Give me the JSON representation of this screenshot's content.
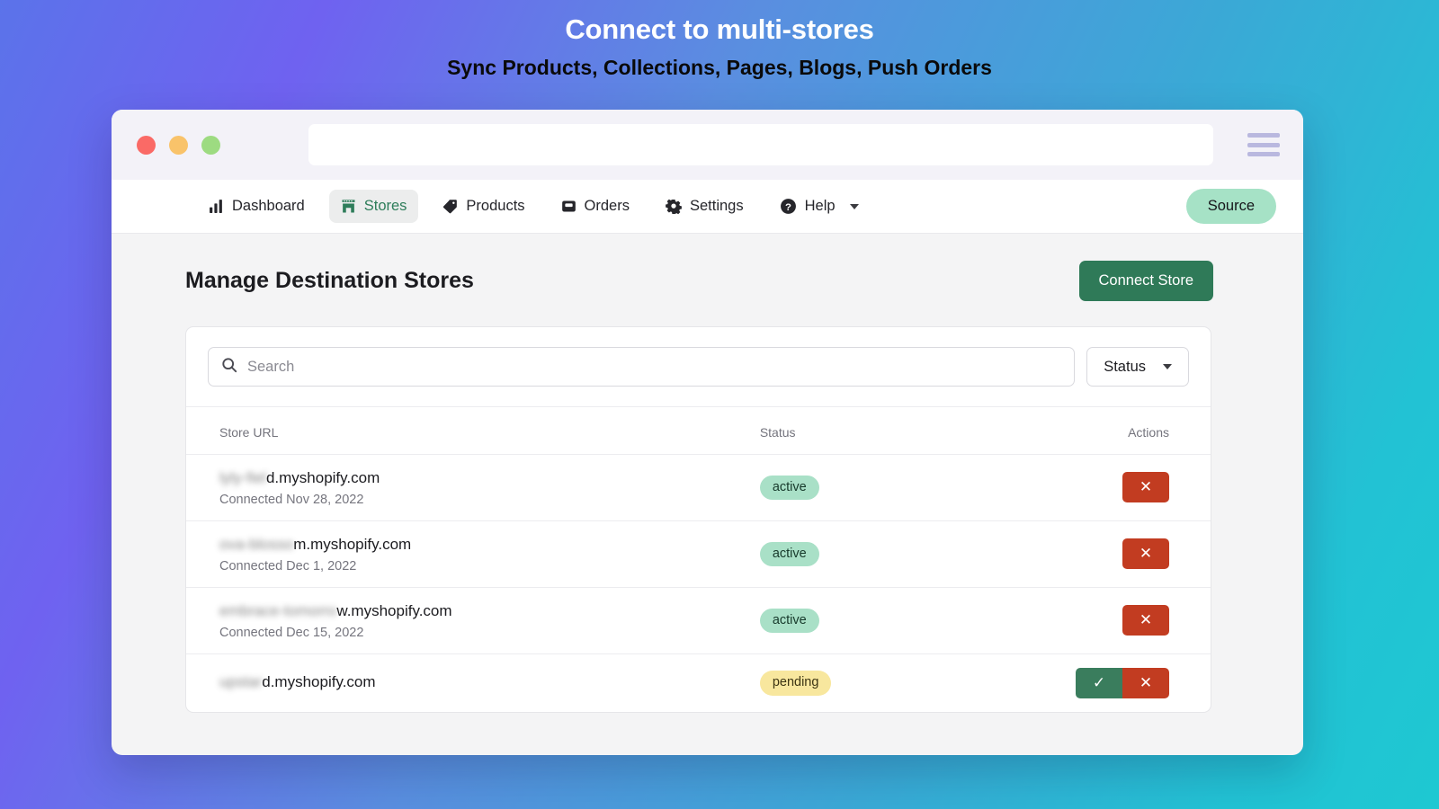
{
  "promo": {
    "title": "Connect to multi-stores",
    "subtitle": "Sync Products, Collections, Pages, Blogs, Push Orders"
  },
  "browser": {
    "url_value": "",
    "url_placeholder": "",
    "menu_icon": "hamburger-menu-icon",
    "traffic_lights": [
      "close",
      "minimize",
      "zoom"
    ]
  },
  "nav": {
    "items": [
      {
        "label": "Dashboard",
        "icon": "bar-chart-icon",
        "active": false
      },
      {
        "label": "Stores",
        "icon": "storefront-icon",
        "active": true
      },
      {
        "label": "Products",
        "icon": "tag-icon",
        "active": false
      },
      {
        "label": "Orders",
        "icon": "inbox-icon",
        "active": false
      },
      {
        "label": "Settings",
        "icon": "gear-icon",
        "active": false
      },
      {
        "label": "Help",
        "icon": "question-circle-icon",
        "active": false,
        "caret": true
      }
    ],
    "source_label": "Source"
  },
  "page": {
    "title": "Manage Destination Stores",
    "connect_button": "Connect Store"
  },
  "toolbar": {
    "search_placeholder": "Search",
    "search_value": "",
    "search_icon": "search-icon",
    "status_label": "Status",
    "status_caret_icon": "chevron-down-icon"
  },
  "table": {
    "headers": {
      "url": "Store URL",
      "status": "Status",
      "actions": "Actions"
    },
    "rows": [
      {
        "redacted_prefix": "lyly-fiel",
        "url_visible": "d.myshopify.com",
        "connected": "Connected Nov 28, 2022",
        "status": "active",
        "actions": [
          "reject"
        ]
      },
      {
        "redacted_prefix": "ova-blosso",
        "url_visible": "m.myshopify.com",
        "connected": "Connected Dec 1, 2022",
        "status": "active",
        "actions": [
          "reject"
        ]
      },
      {
        "redacted_prefix": "embrace-tomorro",
        "url_visible": "w.myshopify.com",
        "connected": "Connected Dec 15, 2022",
        "status": "active",
        "actions": [
          "reject"
        ]
      },
      {
        "redacted_prefix": "upstar",
        "url_visible": "d.myshopify.com",
        "connected": "",
        "status": "pending",
        "actions": [
          "approve",
          "reject"
        ]
      }
    ]
  },
  "colors": {
    "brand_green": "#2f7a58",
    "source_pill": "#a6e2c6",
    "badge_active": "#a9e0c7",
    "badge_pending": "#f8e79e",
    "danger_red": "#c23c21",
    "approve_green": "#3a7d5d",
    "gradient_from": "#5b73ea",
    "gradient_to": "#1ec8d2"
  },
  "glyphs": {
    "check": "✓",
    "cross": "✕"
  }
}
